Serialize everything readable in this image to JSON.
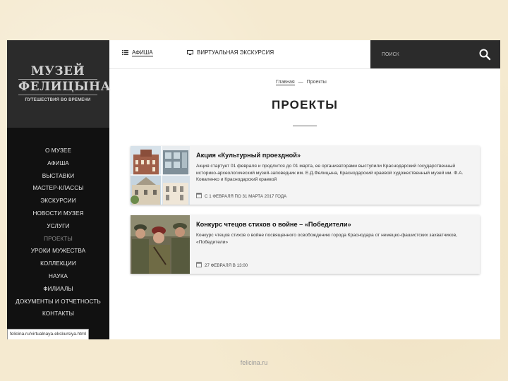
{
  "sidebar": {
    "logo": {
      "line1": "МУЗЕЙ",
      "line2": "ФЕЛИЦЫНА",
      "tagline": "ПУТЕШЕСТВИЯ ВО ВРЕМЕНИ"
    },
    "items": [
      {
        "label": "О МУЗЕЕ"
      },
      {
        "label": "АФИША"
      },
      {
        "label": "ВЫСТАВКИ"
      },
      {
        "label": "МАСТЕР-КЛАССЫ"
      },
      {
        "label": "ЭКСКУРСИИ"
      },
      {
        "label": "НОВОСТИ МУЗЕЯ"
      },
      {
        "label": "УСЛУГИ"
      },
      {
        "label": "ПРОЕКТЫ"
      },
      {
        "label": "УРОКИ МУЖЕСТВА"
      },
      {
        "label": "КОЛЛЕКЦИИ"
      },
      {
        "label": "НАУКА"
      },
      {
        "label": "ФИЛИАЛЫ"
      },
      {
        "label": "ДОКУМЕНТЫ И ОТЧЕТНОСТЬ"
      },
      {
        "label": "КОНТАКТЫ"
      }
    ],
    "status_url": "felicina.ru/virtualnaya-ekskursiya.html"
  },
  "topbar": {
    "tab_afisha": "АФИША",
    "tab_virtual": "ВИРТУАЛЬНАЯ ЭКСКУРСИЯ",
    "search_placeholder": "ПОИСК"
  },
  "breadcrumb": {
    "home": "Главная",
    "separator": "—",
    "current": "Проекты"
  },
  "page": {
    "title": "ПРОЕКТЫ"
  },
  "projects": [
    {
      "title": "Акция «Культурный проездной»",
      "text": "Акция стартует 01 февраля и продлится до 01 марта, ее организаторами выступили Краснодарский государственный историко-археологический музей-заповедник им. Е.Д.Фелицына, Краснодарский краевой художественный музей им. Ф.А. Коваленко и Краснодарский краевой",
      "date": "С 1 ФЕВРАЛЯ ПО 31 МАРТА 2017 ГОДА"
    },
    {
      "title": "Конкурс чтецов стихов о войне – «Победители»",
      "text": "Конкурс чтецов стихов о войне посвященного освобождению города Краснодара от немецко-фашистских захватчиков, «Победители»",
      "date": "27 ФЕВРАЛЯ В 13:00"
    }
  ],
  "footer": {
    "source": "felicina.ru"
  },
  "colors": {
    "sidebar_bg": "#111111",
    "logo_bg": "#2b2b2b",
    "slide_bg": "#f5ead0"
  }
}
